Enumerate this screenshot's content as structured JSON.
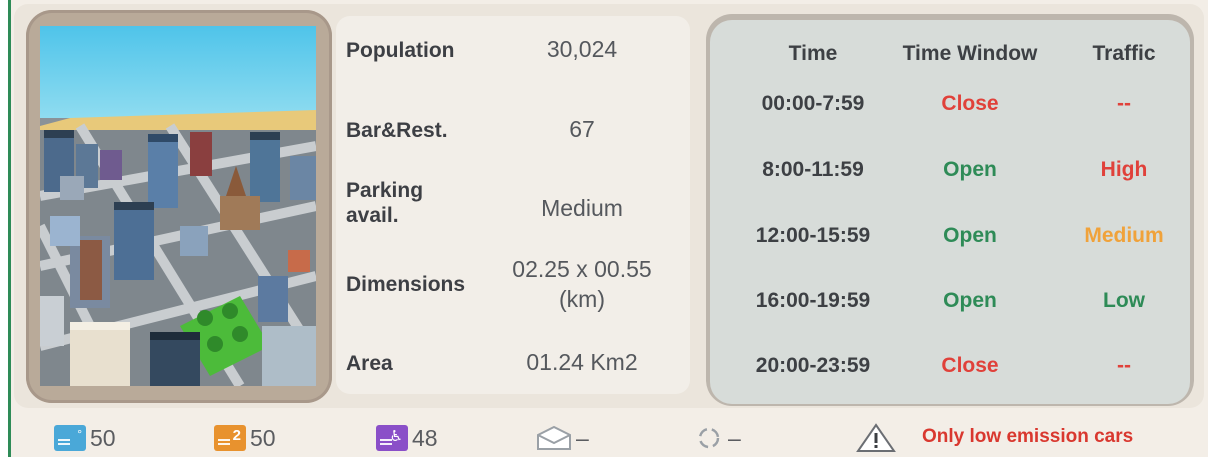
{
  "info": {
    "population_label": "Population",
    "population_value": "30,024",
    "bars_label": "Bar&Rest.",
    "bars_value": "67",
    "parking_label_1": "Parking",
    "parking_label_2": "avail.",
    "parking_value": "Medium",
    "dimensions_label": "Dimensions",
    "dimensions_value_1": "02.25 x 00.55",
    "dimensions_value_2": "(km)",
    "area_label": "Area",
    "area_value": "01.24 Km2"
  },
  "schedule": {
    "headers": {
      "time": "Time",
      "window": "Time Window",
      "traffic": "Traffic"
    },
    "rows": [
      {
        "time": "00:00-7:59",
        "window": "Close",
        "traffic": "--"
      },
      {
        "time": "8:00-11:59",
        "window": "Open",
        "traffic": "High"
      },
      {
        "time": "12:00-15:59",
        "window": "Open",
        "traffic": "Medium"
      },
      {
        "time": "16:00-19:59",
        "window": "Open",
        "traffic": "Low"
      },
      {
        "time": "20:00-23:59",
        "window": "Close",
        "traffic": "--"
      }
    ]
  },
  "bottom": {
    "standard_spots": "50",
    "premium_spots": "50",
    "special_spots": "48",
    "delivery_value": "–",
    "recurring_value": "–",
    "warning": "Only low emission cars"
  },
  "colors": {
    "open": "#2e8b57",
    "close": "#e0413a",
    "high": "#e0413a",
    "medium": "#f0a23a",
    "low": "#2e8b57",
    "accent_green": "#2e8b57",
    "tag_blue": "#4aa8d8",
    "tag_orange": "#e8922e",
    "tag_purple": "#8a4fc8"
  }
}
